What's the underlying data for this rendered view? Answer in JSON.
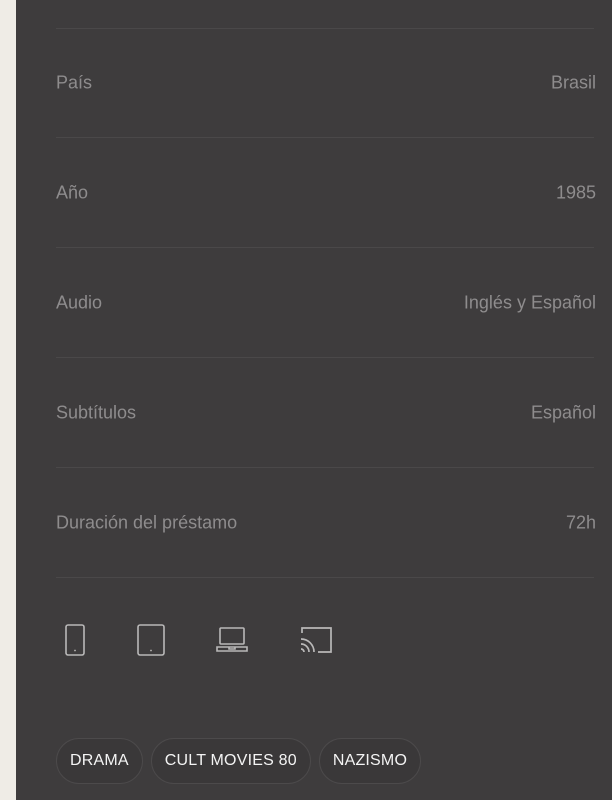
{
  "details": [
    {
      "label": "País",
      "value": "Brasil"
    },
    {
      "label": "Año",
      "value": "1985"
    },
    {
      "label": "Audio",
      "value": "Inglés y Español"
    },
    {
      "label": "Subtítulos",
      "value": "Español"
    },
    {
      "label": "Duración del préstamo",
      "value": "72h"
    }
  ],
  "devices": [
    {
      "icon": "smartphone-icon"
    },
    {
      "icon": "tablet-icon"
    },
    {
      "icon": "laptop-icon"
    },
    {
      "icon": "cast-icon"
    }
  ],
  "tags": [
    "DRAMA",
    "CULT MOVIES 80",
    "NAZISMO"
  ],
  "colors": {
    "page_background": "#efece6",
    "panel_background": "#3e3c3d",
    "muted_text": "#8e8c8d",
    "tag_text": "#f4f4f4"
  }
}
